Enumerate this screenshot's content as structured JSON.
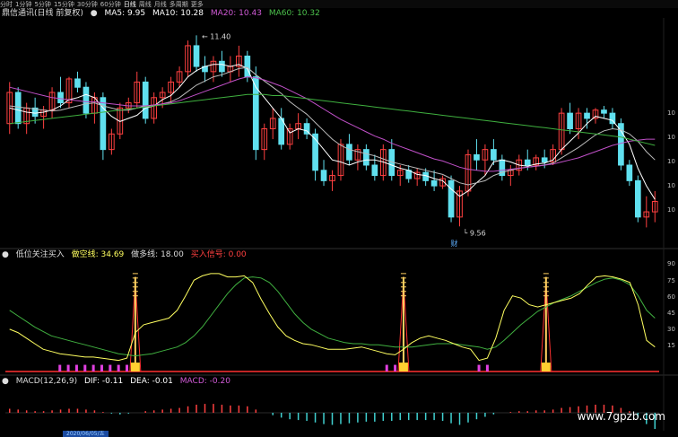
{
  "toolbar": [
    "分时",
    "1分钟",
    "5分钟",
    "15分钟",
    "30分钟",
    "60分钟",
    "日线",
    "周线",
    "月线",
    "多周期",
    "更多"
  ],
  "toolbar_active": 6,
  "main_header": {
    "title": "鼎信通讯(日线 前复权)",
    "ma5": "MA5: 9.95",
    "ma10": "MA10: 10.28",
    "ma20": "MA20: 10.43",
    "ma60": "MA60: 10.32",
    "colors": {
      "ma5": "#ffffff",
      "ma10": "#ffffff",
      "ma20": "#d05ad6",
      "ma60": "#4cc24c"
    }
  },
  "annotations": {
    "high": "11.40",
    "low": "9.56",
    "marker": "财"
  },
  "y_axis_right": [
    "10",
    "10",
    "10",
    "10",
    "10"
  ],
  "ind_header": {
    "name": "低位关注买入",
    "kong": "做空线: 34.69",
    "duo": "做多线: 18.00",
    "buy": "买入信号: 0.00"
  },
  "ind_axis": [
    "90",
    "75",
    "60",
    "45",
    "30",
    "15"
  ],
  "macd_header": {
    "name": "MACD(12,26,9)",
    "dif": "DIF: -0.11",
    "dea": "DEA: -0.01",
    "macd": "MACD: -0.20"
  },
  "date_label": "2020/06/05/五",
  "watermark": "www.7gpzb.com",
  "chart_data": [
    {
      "type": "candlestick",
      "title": "鼎信通讯(日线 前复权)",
      "up_color": "#ff4040",
      "down_color": "#60e0ef",
      "ylim": [
        9.45,
        11.55
      ],
      "candles": [
        [
          10.55,
          10.95,
          10.45,
          10.85
        ],
        [
          10.85,
          10.9,
          10.5,
          10.55
        ],
        [
          10.55,
          10.75,
          10.45,
          10.7
        ],
        [
          10.7,
          10.8,
          10.55,
          10.62
        ],
        [
          10.62,
          10.72,
          10.5,
          10.68
        ],
        [
          10.68,
          10.9,
          10.6,
          10.85
        ],
        [
          10.85,
          11.0,
          10.7,
          10.75
        ],
        [
          10.75,
          11.0,
          10.7,
          10.98
        ],
        [
          10.98,
          11.05,
          10.85,
          10.9
        ],
        [
          10.9,
          10.95,
          10.6,
          10.65
        ],
        [
          10.65,
          10.85,
          10.55,
          10.8
        ],
        [
          10.8,
          10.85,
          10.2,
          10.3
        ],
        [
          10.3,
          10.5,
          10.25,
          10.45
        ],
        [
          10.45,
          10.75,
          10.4,
          10.7
        ],
        [
          10.7,
          10.8,
          10.65,
          10.75
        ],
        [
          10.75,
          11.05,
          10.7,
          10.95
        ],
        [
          10.95,
          11.0,
          10.55,
          10.6
        ],
        [
          10.6,
          10.85,
          10.55,
          10.8
        ],
        [
          10.8,
          10.9,
          10.7,
          10.85
        ],
        [
          10.85,
          11.0,
          10.75,
          10.95
        ],
        [
          10.95,
          11.1,
          10.9,
          11.05
        ],
        [
          11.05,
          11.35,
          11.0,
          11.3
        ],
        [
          11.3,
          11.4,
          11.05,
          11.1
        ],
        [
          11.1,
          11.2,
          10.95,
          11.05
        ],
        [
          11.05,
          11.2,
          10.95,
          11.15
        ],
        [
          11.15,
          11.25,
          11.0,
          11.05
        ],
        [
          11.05,
          11.2,
          10.95,
          11.1
        ],
        [
          11.1,
          11.3,
          11.0,
          11.2
        ],
        [
          11.2,
          11.25,
          10.95,
          11.0
        ],
        [
          11.0,
          11.1,
          10.2,
          10.3
        ],
        [
          10.3,
          10.55,
          10.2,
          10.5
        ],
        [
          10.5,
          10.7,
          10.4,
          10.6
        ],
        [
          10.6,
          10.7,
          10.3,
          10.35
        ],
        [
          10.35,
          10.55,
          10.3,
          10.5
        ],
        [
          10.5,
          10.65,
          10.4,
          10.55
        ],
        [
          10.55,
          10.6,
          10.4,
          10.45
        ],
        [
          10.45,
          10.5,
          10.0,
          10.1
        ],
        [
          10.1,
          10.2,
          9.95,
          10.0
        ],
        [
          10.0,
          10.1,
          9.9,
          10.05
        ],
        [
          10.05,
          10.4,
          10.0,
          10.35
        ],
        [
          10.35,
          10.45,
          10.15,
          10.2
        ],
        [
          10.2,
          10.35,
          10.1,
          10.3
        ],
        [
          10.3,
          10.35,
          10.1,
          10.15
        ],
        [
          10.15,
          10.25,
          10.0,
          10.05
        ],
        [
          10.05,
          10.35,
          10.0,
          10.3
        ],
        [
          10.3,
          10.4,
          10.0,
          10.05
        ],
        [
          10.05,
          10.15,
          9.95,
          10.1
        ],
        [
          10.1,
          10.15,
          9.98,
          10.02
        ],
        [
          10.02,
          10.12,
          9.95,
          10.08
        ],
        [
          10.08,
          10.12,
          9.95,
          10.0
        ],
        [
          10.0,
          10.1,
          9.9,
          9.95
        ],
        [
          9.95,
          10.05,
          9.92,
          10.02
        ],
        [
          10.0,
          10.05,
          9.6,
          9.65
        ],
        [
          9.65,
          9.95,
          9.56,
          9.9
        ],
        [
          9.9,
          10.3,
          9.85,
          10.25
        ],
        [
          10.25,
          10.4,
          10.1,
          10.2
        ],
        [
          10.2,
          10.35,
          10.05,
          10.3
        ],
        [
          10.3,
          10.4,
          10.15,
          10.2
        ],
        [
          10.2,
          10.25,
          10.0,
          10.05
        ],
        [
          10.05,
          10.15,
          9.95,
          10.1
        ],
        [
          10.1,
          10.25,
          10.05,
          10.2
        ],
        [
          10.2,
          10.3,
          10.1,
          10.15
        ],
        [
          10.15,
          10.25,
          10.1,
          10.22
        ],
        [
          10.22,
          10.3,
          10.12,
          10.18
        ],
        [
          10.18,
          10.35,
          10.15,
          10.3
        ],
        [
          10.3,
          10.7,
          10.25,
          10.65
        ],
        [
          10.65,
          10.75,
          10.45,
          10.5
        ],
        [
          10.5,
          10.7,
          10.4,
          10.65
        ],
        [
          10.65,
          10.7,
          10.5,
          10.6
        ],
        [
          10.6,
          10.7,
          10.55,
          10.68
        ],
        [
          10.68,
          10.72,
          10.6,
          10.65
        ],
        [
          10.65,
          10.7,
          10.5,
          10.55
        ],
        [
          10.55,
          10.6,
          10.1,
          10.15
        ],
        [
          10.15,
          10.2,
          9.95,
          10.0
        ],
        [
          10.0,
          10.05,
          9.6,
          9.65
        ],
        [
          9.65,
          9.85,
          9.55,
          9.7
        ],
        [
          9.7,
          9.9,
          9.6,
          9.8
        ]
      ],
      "ma5": [
        10.7,
        10.68,
        10.66,
        10.65,
        10.66,
        10.68,
        10.72,
        10.78,
        10.8,
        10.83,
        10.8,
        10.7,
        10.62,
        10.57,
        10.6,
        10.63,
        10.7,
        10.72,
        10.78,
        10.82,
        10.9,
        11.0,
        11.06,
        11.1,
        11.12,
        11.12,
        11.1,
        11.12,
        11.08,
        10.9,
        10.8,
        10.7,
        10.6,
        10.46,
        10.5,
        10.48,
        10.4,
        10.3,
        10.2,
        10.18,
        10.15,
        10.18,
        10.2,
        10.2,
        10.18,
        10.15,
        10.12,
        10.1,
        10.06,
        10.05,
        10.02,
        10.0,
        9.92,
        9.85,
        9.9,
        9.98,
        10.05,
        10.18,
        10.2,
        10.18,
        10.15,
        10.14,
        10.16,
        10.17,
        10.2,
        10.3,
        10.38,
        10.46,
        10.55,
        10.62,
        10.6,
        10.58,
        10.48,
        10.35,
        10.12,
        9.95,
        9.82
      ],
      "ma10": [
        10.72,
        10.71,
        10.7,
        10.69,
        10.68,
        10.67,
        10.68,
        10.7,
        10.72,
        10.74,
        10.75,
        10.72,
        10.7,
        10.68,
        10.68,
        10.7,
        10.72,
        10.72,
        10.74,
        10.76,
        10.8,
        10.86,
        10.92,
        10.96,
        11.0,
        11.02,
        11.05,
        11.08,
        11.09,
        11.02,
        10.96,
        10.9,
        10.84,
        10.76,
        10.7,
        10.64,
        10.56,
        10.48,
        10.4,
        10.34,
        10.3,
        10.28,
        10.26,
        10.24,
        10.21,
        10.18,
        10.16,
        10.14,
        10.12,
        10.1,
        10.08,
        10.06,
        10.02,
        9.98,
        9.96,
        9.98,
        10.0,
        10.05,
        10.08,
        10.1,
        10.12,
        10.13,
        10.14,
        10.15,
        10.17,
        10.22,
        10.27,
        10.32,
        10.38,
        10.44,
        10.48,
        10.5,
        10.49,
        10.45,
        10.38,
        10.28,
        10.2
      ],
      "ma20": [
        10.9,
        10.88,
        10.86,
        10.84,
        10.82,
        10.8,
        10.79,
        10.78,
        10.77,
        10.76,
        10.76,
        10.75,
        10.74,
        10.73,
        10.72,
        10.72,
        10.72,
        10.73,
        10.74,
        10.75,
        10.77,
        10.8,
        10.83,
        10.86,
        10.89,
        10.92,
        10.95,
        10.98,
        11.0,
        10.99,
        10.97,
        10.94,
        10.91,
        10.87,
        10.83,
        10.79,
        10.74,
        10.69,
        10.64,
        10.59,
        10.55,
        10.51,
        10.47,
        10.43,
        10.4,
        10.36,
        10.33,
        10.3,
        10.27,
        10.24,
        10.21,
        10.19,
        10.16,
        10.13,
        10.11,
        10.1,
        10.09,
        10.09,
        10.1,
        10.11,
        10.12,
        10.13,
        10.14,
        10.15,
        10.16,
        10.18,
        10.2,
        10.22,
        10.25,
        10.28,
        10.31,
        10.34,
        10.36,
        10.38,
        10.39,
        10.4,
        10.4
      ],
      "ma60": [
        10.55,
        10.56,
        10.57,
        10.58,
        10.59,
        10.6,
        10.61,
        10.62,
        10.63,
        10.64,
        10.65,
        10.66,
        10.67,
        10.68,
        10.69,
        10.7,
        10.71,
        10.72,
        10.73,
        10.74,
        10.75,
        10.76,
        10.77,
        10.78,
        10.79,
        10.8,
        10.81,
        10.82,
        10.83,
        10.83,
        10.83,
        10.82,
        10.82,
        10.81,
        10.8,
        10.79,
        10.78,
        10.77,
        10.76,
        10.75,
        10.74,
        10.73,
        10.72,
        10.71,
        10.7,
        10.69,
        10.68,
        10.67,
        10.66,
        10.65,
        10.64,
        10.63,
        10.62,
        10.61,
        10.6,
        10.59,
        10.58,
        10.57,
        10.56,
        10.55,
        10.54,
        10.53,
        10.52,
        10.51,
        10.5,
        10.49,
        10.48,
        10.47,
        10.46,
        10.45,
        10.44,
        10.43,
        10.42,
        10.4,
        10.38,
        10.36,
        10.34
      ]
    },
    {
      "type": "line",
      "title": "低位关注买入",
      "ylim": [
        0,
        100
      ],
      "series": [
        {
          "name": "做空线",
          "color": "#ffff60",
          "values": [
            38,
            35,
            30,
            25,
            20,
            18,
            16,
            15,
            14,
            13,
            13,
            12,
            11,
            10,
            12,
            35,
            42,
            44,
            46,
            48,
            55,
            68,
            82,
            86,
            88,
            88,
            85,
            85,
            86,
            80,
            65,
            52,
            40,
            32,
            28,
            25,
            24,
            22,
            20,
            20,
            20,
            21,
            22,
            20,
            18,
            16,
            15,
            20,
            26,
            30,
            32,
            30,
            28,
            25,
            22,
            20,
            10,
            12,
            30,
            55,
            68,
            66,
            60,
            58,
            60,
            62,
            64,
            66,
            70,
            78,
            85,
            86,
            85,
            83,
            80,
            60,
            28,
            22
          ]
        },
        {
          "name": "做多线",
          "color": "#40b040",
          "values": [
            55,
            50,
            45,
            40,
            36,
            32,
            30,
            28,
            26,
            24,
            22,
            20,
            18,
            16,
            15,
            14,
            15,
            16,
            18,
            20,
            22,
            26,
            32,
            40,
            50,
            60,
            70,
            78,
            84,
            85,
            84,
            80,
            72,
            62,
            52,
            44,
            38,
            34,
            30,
            28,
            26,
            25,
            25,
            24,
            24,
            23,
            22,
            22,
            22,
            23,
            24,
            25,
            25,
            25,
            24,
            23,
            22,
            20,
            22,
            28,
            35,
            42,
            48,
            54,
            58,
            62,
            65,
            68,
            72,
            76,
            80,
            83,
            84,
            82,
            78,
            68,
            55,
            48
          ]
        },
        {
          "name": "买入信号",
          "color": "#ff2020",
          "values": [
            0,
            0,
            0,
            0,
            0,
            0,
            0,
            0,
            0,
            0,
            0,
            0,
            0,
            0,
            0,
            0,
            0,
            0,
            0,
            0,
            0,
            0,
            0,
            0,
            0,
            0,
            0,
            0,
            0,
            0,
            0,
            0,
            0,
            0,
            0,
            0,
            0,
            0,
            0,
            0,
            0,
            0,
            0,
            0,
            0,
            0,
            0,
            0,
            0,
            0,
            0,
            0,
            0,
            0,
            0,
            0,
            0,
            0,
            0,
            0,
            0,
            0,
            0,
            0,
            0,
            0,
            0,
            0,
            0,
            0,
            0,
            0,
            0,
            0,
            0,
            0,
            0,
            0
          ]
        }
      ],
      "spike_indices": [
        15,
        47,
        64
      ]
    },
    {
      "type": "bar",
      "title": "MACD(12,26,9)",
      "values": [
        0.05,
        0.04,
        0.03,
        0.02,
        0.02,
        0.03,
        0.04,
        0.05,
        0.05,
        0.04,
        0.03,
        0.01,
        -0.01,
        -0.02,
        -0.01,
        0.0,
        0.02,
        0.03,
        0.04,
        0.05,
        0.06,
        0.08,
        0.1,
        0.11,
        0.11,
        0.1,
        0.09,
        0.09,
        0.08,
        0.04,
        0.0,
        -0.03,
        -0.06,
        -0.08,
        -0.09,
        -0.1,
        -0.12,
        -0.14,
        -0.15,
        -0.14,
        -0.13,
        -0.12,
        -0.11,
        -0.11,
        -0.1,
        -0.1,
        -0.09,
        -0.09,
        -0.09,
        -0.09,
        -0.09,
        -0.1,
        -0.13,
        -0.15,
        -0.12,
        -0.08,
        -0.05,
        -0.02,
        0.0,
        0.01,
        0.02,
        0.02,
        0.03,
        0.03,
        0.04,
        0.06,
        0.07,
        0.08,
        0.09,
        0.1,
        0.1,
        0.09,
        0.06,
        0.02,
        -0.06,
        -0.14,
        -0.2
      ]
    }
  ]
}
